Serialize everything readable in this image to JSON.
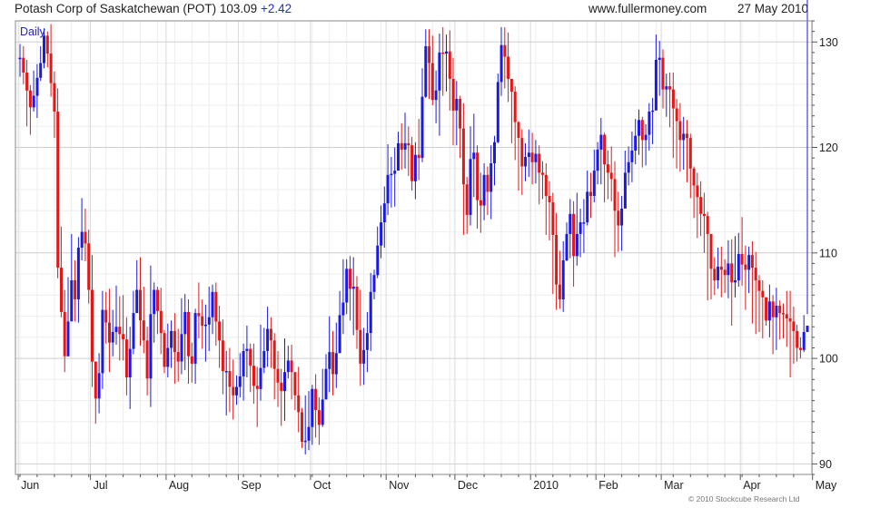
{
  "header": {
    "title": "Potash Corp of Saskatchewan (POT)",
    "last": "103.09",
    "change": "+2.42",
    "site": "www.fullermoney.com",
    "date": "27 May 2010"
  },
  "footer": {
    "copyright": "© 2010 Stockcube Research Ltd"
  },
  "chart_data": {
    "type": "candlestick",
    "period": "Daily",
    "colors": {
      "up": "#1a1ae6",
      "down": "#e01818",
      "grid": "#d9d9d9",
      "frame": "#888888"
    },
    "y_axis": {
      "position": "right",
      "ylim": [
        89,
        132
      ],
      "ticks": [
        "90",
        "100",
        "110",
        "120",
        "130"
      ]
    },
    "x_axis": {
      "labels": [
        "Jun",
        "Jul",
        "Aug",
        "Sep",
        "Oct",
        "Nov",
        "Dec",
        "2010",
        "Feb",
        "Mar",
        "Apr",
        "May"
      ]
    },
    "month_start_index": [
      0,
      21,
      43,
      64,
      85,
      107,
      127,
      149,
      168,
      187,
      210,
      231
    ],
    "close": [
      128.5,
      127.1,
      125.4,
      123.8,
      124.9,
      126.6,
      128.0,
      130.6,
      128.9,
      126.1,
      123.4,
      108.6,
      104.4,
      100.2,
      103.5,
      107.4,
      105.6,
      110.5,
      112.0,
      110.9,
      106.5,
      99.7,
      96.2,
      98.6,
      104.6,
      103.4,
      101.5,
      102.5,
      103.0,
      102.3,
      101.8,
      98.2,
      100.9,
      104.3,
      106.5,
      103.6,
      101.7,
      98.1,
      104.2,
      106.5,
      104.5,
      102.4,
      99.2,
      101.0,
      102.6,
      100.6,
      99.7,
      102.3,
      104.4,
      100.2,
      99.5,
      104.3,
      104.0,
      103.1,
      103.2,
      103.9,
      106.3,
      103.5,
      101.7,
      98.8,
      98.8,
      97.3,
      96.5,
      97.3,
      98.3,
      100.7,
      100.9,
      99.3,
      97.4,
      97.1,
      99.1,
      100.7,
      102.8,
      101.7,
      99.0,
      97.7,
      96.9,
      98.7,
      99.8,
      98.7,
      96.5,
      94.9,
      92.1,
      92.2,
      93.5,
      97.1,
      95.1,
      93.7,
      96.1,
      99.0,
      100.6,
      98.5,
      100.5,
      104.1,
      105.3,
      108.5,
      106.6,
      106.8,
      102.7,
      99.5,
      100.8,
      102.4,
      106.3,
      107.9,
      110.7,
      112.9,
      114.7,
      117.4,
      117.5,
      117.8,
      120.4,
      119.8,
      120.4,
      120.2,
      116.8,
      119.3,
      119.0,
      124.8,
      129.6,
      128.0,
      124.5,
      125.4,
      129.0,
      128.9,
      129.1,
      126.5,
      123.5,
      124.6,
      121.8,
      116.5,
      113.6,
      118.9,
      119.5,
      115.0,
      114.5,
      117.4,
      115.8,
      118.5,
      120.5,
      126.2,
      129.7,
      128.6,
      126.5,
      125.3,
      122.4,
      120.9,
      118.2,
      119.1,
      119.5,
      118.6,
      119.4,
      117.6,
      117.4,
      115.4,
      114.8,
      111.7,
      107.0,
      105.6,
      109.3,
      111.8,
      113.7,
      109.7,
      111.8,
      112.9,
      112.9,
      115.8,
      115.4,
      117.8,
      119.8,
      121.2,
      118.4,
      117.6,
      117.0,
      114.0,
      112.6,
      114.2,
      117.6,
      118.6,
      119.7,
      121.1,
      122.6,
      120.7,
      121.2,
      123.4,
      123.5,
      128.3,
      128.5,
      125.5,
      125.8,
      125.5,
      123.7,
      122.5,
      120.7,
      121.3,
      120.9,
      118.0,
      116.4,
      115.3,
      113.7,
      113.5,
      111.8,
      108.5,
      107.4,
      108.7,
      108.4,
      107.9,
      109.0,
      107.2,
      107.4,
      109.9,
      108.9,
      108.4,
      109.8,
      108.6,
      107.4,
      106.4,
      105.8,
      103.6,
      105.4,
      103.9,
      105.0,
      104.3,
      104.2,
      103.8,
      103.5,
      102.6,
      101.0,
      100.8,
      102.5,
      103.1
    ],
    "high": [
      129.8,
      129.6,
      128.3,
      125.9,
      127.3,
      127.9,
      129.6,
      131.3,
      131.0,
      131.7,
      127.2,
      125.6,
      112.5,
      106.5,
      107.7,
      111.8,
      109.3,
      111.5,
      115.2,
      114.2,
      112.2,
      109.8,
      99.7,
      100.5,
      106.4,
      106.3,
      106.6,
      104.6,
      106.9,
      105.9,
      106.0,
      103.9,
      103.0,
      106.4,
      109.3,
      109.6,
      106.8,
      103.0,
      108.8,
      107.2,
      106.8,
      106.7,
      102.7,
      103.3,
      103.6,
      104.3,
      102.8,
      105.7,
      106.1,
      105.6,
      101.5,
      104.7,
      107.2,
      105.6,
      105.1,
      106.8,
      107.0,
      107.2,
      105.0,
      103.7,
      100.7,
      101.0,
      99.9,
      98.4,
      100.5,
      101.4,
      103.1,
      101.4,
      101.4,
      99.2,
      103.2,
      102.9,
      104.9,
      103.9,
      102.4,
      100.7,
      99.0,
      101.9,
      101.2,
      101.3,
      98.7,
      99.2,
      95.3,
      96.5,
      96.9,
      97.5,
      98.5,
      96.3,
      99.0,
      100.4,
      104.0,
      102.6,
      103.4,
      106.4,
      109.4,
      109.4,
      109.7,
      109.6,
      107.8,
      106.5,
      102.9,
      104.4,
      108.1,
      108.4,
      112.5,
      114.5,
      116.3,
      120.3,
      119.1,
      120.0,
      121.5,
      122.3,
      123.3,
      122.0,
      121.0,
      120.5,
      122.7,
      127.5,
      131.2,
      131.2,
      130.6,
      127.3,
      130.8,
      131.4,
      130.7,
      131.1,
      128.5,
      126.3,
      124.9,
      124.2,
      117.2,
      122.0,
      123.2,
      120.2,
      117.6,
      118.5,
      118.2,
      120.2,
      121.1,
      127.0,
      131.4,
      131.4,
      130.9,
      126.5,
      125.8,
      122.5,
      121.7,
      120.4,
      121.7,
      121.4,
      120.7,
      120.2,
      118.7,
      118.5,
      116.8,
      115.7,
      113.8,
      110.2,
      111.1,
      112.9,
      115.1,
      114.9,
      115.7,
      114.2,
      115.1,
      117.8,
      117.6,
      119.8,
      120.5,
      122.8,
      121.4,
      119.7,
      120.1,
      118.7,
      115.8,
      115.4,
      119.7,
      120.1,
      121.5,
      122.7,
      123.6,
      122.9,
      122.2,
      124.2,
      124.7,
      130.7,
      130.1,
      129.3,
      127.0,
      127.1,
      127.1,
      124.6,
      124.2,
      122.9,
      122.6,
      121.3,
      118.2,
      117.6,
      116.8,
      115.7,
      113.9,
      111.5,
      109.6,
      110.5,
      110.6,
      109.4,
      111.2,
      111.3,
      111.6,
      111.9,
      113.4,
      110.7,
      110.6,
      111.1,
      110.1,
      107.9,
      107.4,
      105.8,
      107.0,
      106.0,
      106.7,
      105.5,
      105.2,
      106.4,
      106.4,
      104.9,
      103.2,
      102.0,
      104.1,
      104.2
    ],
    "low": [
      126.7,
      126.0,
      122.0,
      121.2,
      123.4,
      122.8,
      126.3,
      127.5,
      127.6,
      124.8,
      120.9,
      107.6,
      103.9,
      98.7,
      100.4,
      106.2,
      103.5,
      103.4,
      109.3,
      109.2,
      105.2,
      97.3,
      93.8,
      94.8,
      97.1,
      101.4,
      98.7,
      100.2,
      101.3,
      99.8,
      99.8,
      96.5,
      95.2,
      100.4,
      104.8,
      101.2,
      100.5,
      96.5,
      95.4,
      101.5,
      102.3,
      100.4,
      98.6,
      98.2,
      99.1,
      97.6,
      97.8,
      98.5,
      98.9,
      97.6,
      97.7,
      97.6,
      101.9,
      100.9,
      99.7,
      100.7,
      102.3,
      101.2,
      99.1,
      96.6,
      94.6,
      94.9,
      94.2,
      95.6,
      96.3,
      96.0,
      98.2,
      96.8,
      95.7,
      93.5,
      96.0,
      98.6,
      99.2,
      99.1,
      96.1,
      95.4,
      93.6,
      94.1,
      98.1,
      96.1,
      95.1,
      93.0,
      91.5,
      90.9,
      91.3,
      91.8,
      92.5,
      91.8,
      93.5,
      97.8,
      96.8,
      96.5,
      97.2,
      101.6,
      102.3,
      104.2,
      103.6,
      102.2,
      100.9,
      97.4,
      97.5,
      98.7,
      100.7,
      105.6,
      107.6,
      109.5,
      110.5,
      113.6,
      114.3,
      114.4,
      118.4,
      117.9,
      118.0,
      117.3,
      115.9,
      115.1,
      116.9,
      118.6,
      124.7,
      124.6,
      124.0,
      122.3,
      121.1,
      124.9,
      125.3,
      123.5,
      120.2,
      120.2,
      119.0,
      111.7,
      111.8,
      112.6,
      115.3,
      112.3,
      111.9,
      113.1,
      113.6,
      113.2,
      116.4,
      120.4,
      124.9,
      125.6,
      124.3,
      120.4,
      118.8,
      115.9,
      115.5,
      116.8,
      117.2,
      116.5,
      116.6,
      114.6,
      115.1,
      111.7,
      111.2,
      106.1,
      104.6,
      104.7,
      104.4,
      109.2,
      109.5,
      106.8,
      108.8,
      109.6,
      110.0,
      112.6,
      113.3,
      114.8,
      116.5,
      116.5,
      114.8,
      115.1,
      114.9,
      109.6,
      110.1,
      110.2,
      115.1,
      116.4,
      116.7,
      118.4,
      119.3,
      118.1,
      118.3,
      119.7,
      120.3,
      124.0,
      124.9,
      123.7,
      122.9,
      121.9,
      119.0,
      118.0,
      117.7,
      117.9,
      116.7,
      115.2,
      113.3,
      111.4,
      111.6,
      110.0,
      105.5,
      105.6,
      106.0,
      106.6,
      105.8,
      106.2,
      105.7,
      103.1,
      105.8,
      106.8,
      106.9,
      104.6,
      106.2,
      103.3,
      102.3,
      102.5,
      101.9,
      103.1,
      102.0,
      100.4,
      100.8,
      101.8,
      101.9,
      101.1,
      98.2,
      99.5,
      99.7,
      100.0,
      100.6
    ]
  }
}
